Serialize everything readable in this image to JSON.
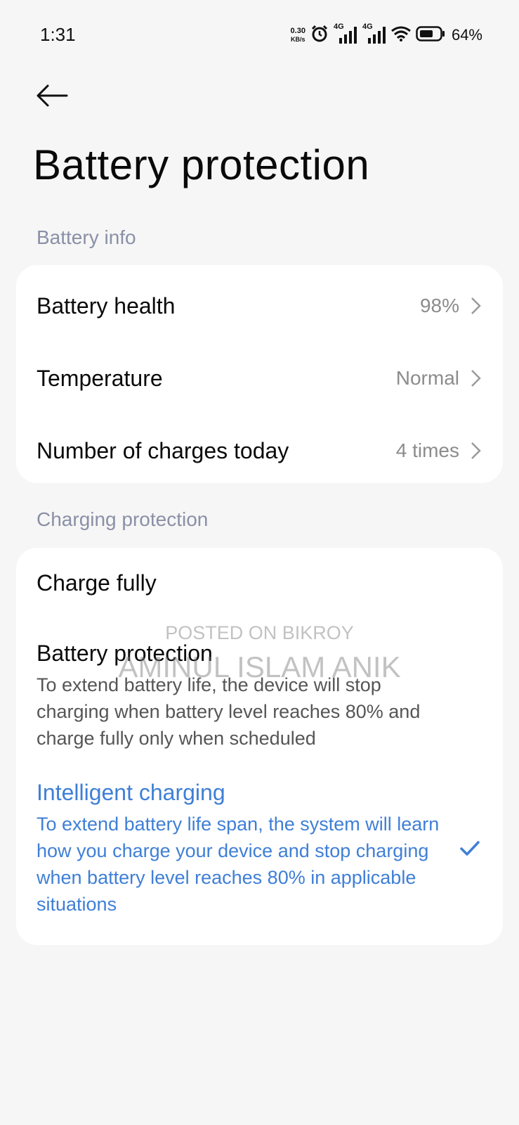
{
  "status_bar": {
    "time": "1:31",
    "net_speed_value": "0.30",
    "net_speed_unit": "KB/s",
    "sim1_label": "4G",
    "sim2_label": "4G",
    "battery_percent": "64%",
    "icons": [
      "alarm-icon",
      "signal-icon",
      "signal-icon",
      "wifi-icon",
      "battery-icon"
    ]
  },
  "header": {
    "back_icon": "arrow-left-icon",
    "title": "Battery protection"
  },
  "battery_info": {
    "section_label": "Battery info",
    "rows": [
      {
        "label": "Battery health",
        "value": "98%"
      },
      {
        "label": "Temperature",
        "value": "Normal"
      },
      {
        "label": "Number of charges today",
        "value": "4 times"
      }
    ]
  },
  "charging_protection": {
    "section_label": "Charging protection",
    "options": [
      {
        "title": "Charge fully",
        "description": "",
        "selected": false
      },
      {
        "title": "Battery protection",
        "description": "To extend battery life, the device will stop charging when battery level reaches 80% and charge fully only when scheduled",
        "selected": false
      },
      {
        "title": "Intelligent charging",
        "description": "To extend battery life span, the system will learn how you charge your device and stop charging when battery level reaches 80% in applicable situations",
        "selected": true
      }
    ]
  },
  "watermark": {
    "line1": "POSTED ON BIKROY",
    "line2": "AMINUL ISLAM ANIK"
  },
  "colors": {
    "background": "#f6f6f6",
    "card": "#ffffff",
    "accent": "#3f7fd6",
    "section_label": "#8a90a6",
    "value_text": "#8c8c8c"
  }
}
